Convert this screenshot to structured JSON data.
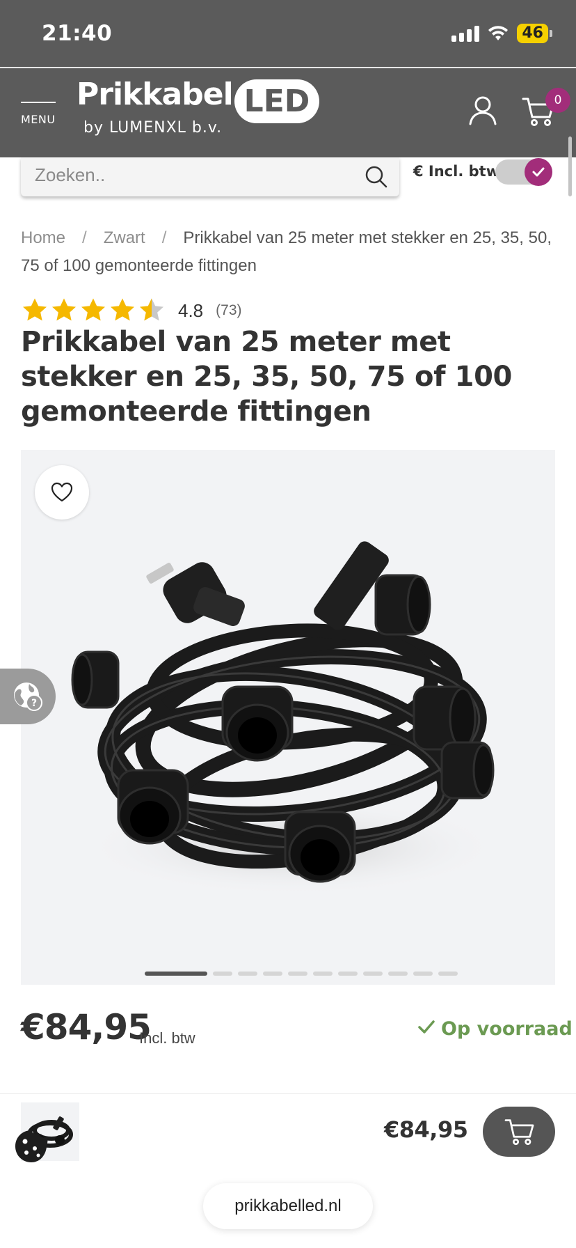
{
  "status_bar": {
    "time": "21:40",
    "battery": "46"
  },
  "header": {
    "menu_label": "MENU",
    "logo_word": "Prikkabel",
    "logo_badge": "LED",
    "logo_sub": "by LUMENXL b.v.",
    "cart_count": "0"
  },
  "search": {
    "placeholder": "Zoeken..",
    "vat_label": "€ Incl. btw",
    "vat_toggle_on": true
  },
  "breadcrumb": {
    "items": [
      "Home",
      "Zwart"
    ],
    "separator": "/",
    "current": "Prikkabel van 25 meter met stekker en 25, 35, 50, 75 of 100 gemonteerde fittingen"
  },
  "rating": {
    "value": "4.8",
    "count": "(73)",
    "stars": 4.5
  },
  "product": {
    "title": "Prikkabel van 25 meter met stekker en 25, 35, 50, 75 of 100 gemonteerde fittingen",
    "price": "€84,95",
    "price_vat": "Incl. btw",
    "stock": "Op voorraad"
  },
  "gallery": {
    "slide_count": 11,
    "active_index": 0
  },
  "sticky": {
    "price": "€84,95"
  },
  "browser": {
    "url": "prikkabelled.nl"
  },
  "colors": {
    "header_bg": "#5b5b5b",
    "accent": "#a22d7a",
    "stock_green": "#6b9a52",
    "star": "#f5b800"
  },
  "icons": [
    "account-icon",
    "cart-icon",
    "search-icon",
    "heart-icon",
    "globe-help-icon",
    "cookie-icon",
    "check-icon"
  ]
}
